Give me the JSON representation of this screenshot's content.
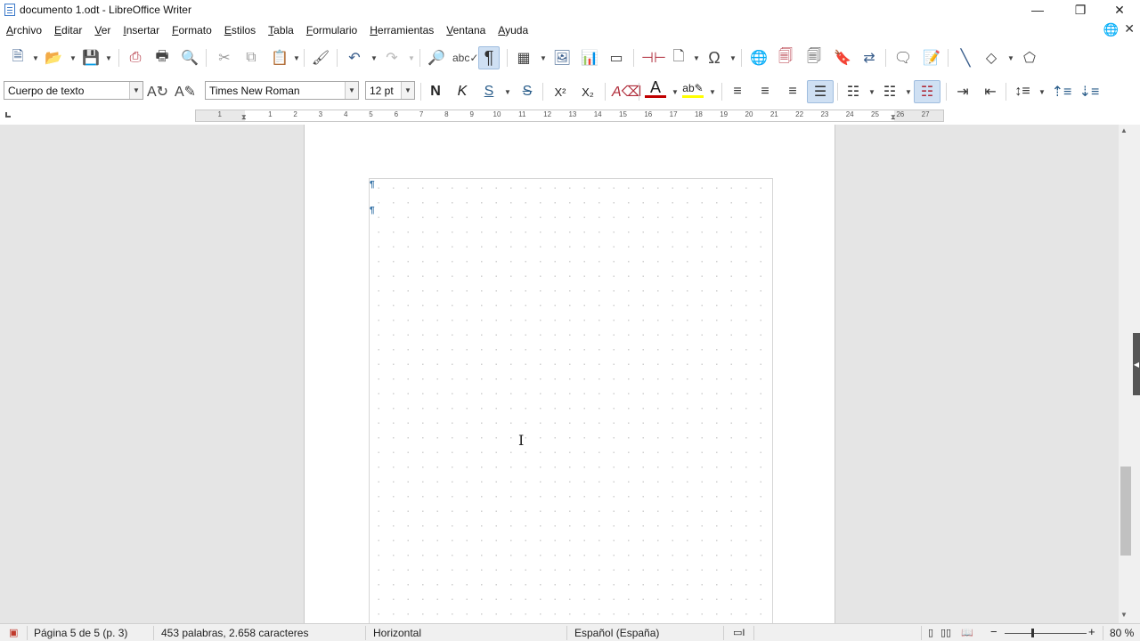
{
  "window": {
    "title": "documento 1.odt - LibreOffice Writer",
    "minimize": "—",
    "restore": "❐",
    "close": "✕"
  },
  "menu": [
    {
      "id": "archivo",
      "label": "Archivo"
    },
    {
      "id": "editar",
      "label": "Editar"
    },
    {
      "id": "ver",
      "label": "Ver"
    },
    {
      "id": "insertar",
      "label": "Insertar"
    },
    {
      "id": "formato",
      "label": "Formato"
    },
    {
      "id": "estilos",
      "label": "Estilos"
    },
    {
      "id": "tabla",
      "label": "Tabla"
    },
    {
      "id": "formulario",
      "label": "Formulario"
    },
    {
      "id": "herramientas",
      "label": "Herramientas"
    },
    {
      "id": "ventana",
      "label": "Ventana"
    },
    {
      "id": "ayuda",
      "label": "Ayuda"
    }
  ],
  "formatting": {
    "paragraph_style": "Cuerpo de texto",
    "font_name": "Times New Roman",
    "font_size": "12 pt",
    "bold": "N",
    "italic": "K",
    "underline": "S",
    "strikethrough": "S",
    "superscript": "X²",
    "subscript": "X₂",
    "font_color": "#c00000",
    "highlight_color": "#ffff00"
  },
  "toolbar_icons": {
    "new": "new-document-icon",
    "open": "open-folder-icon",
    "save": "save-icon",
    "export_pdf": "export-pdf-icon",
    "print": "print-icon",
    "print_preview": "print-preview-icon",
    "cut": "cut-icon",
    "copy": "copy-icon",
    "paste": "paste-icon",
    "clone": "clone-formatting-icon",
    "undo": "undo-icon",
    "redo": "redo-icon",
    "find": "find-replace-icon",
    "spell": "spellcheck-icon",
    "formatting_marks": "formatting-marks-icon",
    "table": "insert-table-icon",
    "image": "insert-image-icon",
    "chart": "insert-chart-icon",
    "textbox": "insert-textbox-icon",
    "pagebreak": "page-break-icon",
    "field": "insert-field-icon",
    "special_char": "special-character-icon",
    "hyperlink": "hyperlink-icon",
    "footnote": "footnote-icon",
    "endnote": "endnote-icon",
    "bookmark": "bookmark-icon",
    "crossref": "cross-reference-icon",
    "comment": "comment-icon",
    "track_changes": "track-changes-icon",
    "line": "line-icon",
    "shapes": "basic-shapes-icon",
    "draw": "draw-functions-icon"
  },
  "ruler_labels": [
    "1",
    "1",
    "2",
    "3",
    "4",
    "5",
    "6",
    "7",
    "8",
    "9",
    "10",
    "11",
    "12",
    "13",
    "14",
    "15",
    "16",
    "17",
    "18",
    "19",
    "20",
    "21",
    "22",
    "23",
    "24",
    "25",
    "26",
    "27"
  ],
  "statusbar": {
    "page": "Página 5 de 5 (p. 3)",
    "words": "453 palabras, 2.658 caracteres",
    "orientation": "Horizontal",
    "language": "Español (España)",
    "zoom": "80 %"
  }
}
